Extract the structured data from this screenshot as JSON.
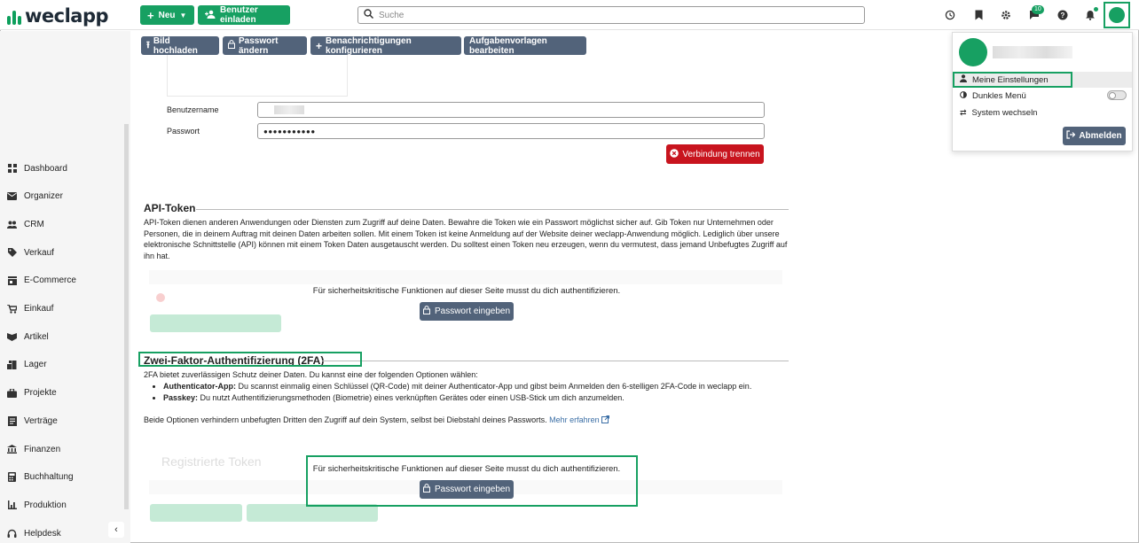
{
  "app": {
    "name": "weclapp"
  },
  "topbar": {
    "new_label": "Neu",
    "invite_label": "Benutzer einladen",
    "search_placeholder": "Suche",
    "notification_count": "10",
    "icons": [
      "history-icon",
      "bookmark-icon",
      "gear-icon",
      "chat-icon",
      "help-icon",
      "bell-icon",
      "avatar"
    ]
  },
  "toolbar": {
    "upload_image": "Bild hochladen",
    "change_password": "Passwort ändern",
    "configure_notifications": "Benachrichtigungen konfigurieren",
    "edit_task_templates": "Aufgabenvorlagen bearbeiten"
  },
  "sidebar": {
    "items": [
      {
        "label": "Dashboard",
        "icon": "dashboard-icon"
      },
      {
        "label": "Organizer",
        "icon": "mail-icon"
      },
      {
        "label": "CRM",
        "icon": "people-icon"
      },
      {
        "label": "Verkauf",
        "icon": "tag-icon"
      },
      {
        "label": "E-Commerce",
        "icon": "store-icon"
      },
      {
        "label": "Einkauf",
        "icon": "cart-icon"
      },
      {
        "label": "Artikel",
        "icon": "box-icon"
      },
      {
        "label": "Lager",
        "icon": "warehouse-icon"
      },
      {
        "label": "Projekte",
        "icon": "briefcase-icon"
      },
      {
        "label": "Verträge",
        "icon": "contract-icon"
      },
      {
        "label": "Finanzen",
        "icon": "bank-icon"
      },
      {
        "label": "Buchhaltung",
        "icon": "calculator-icon"
      },
      {
        "label": "Produktion",
        "icon": "chart-icon"
      },
      {
        "label": "Helpdesk",
        "icon": "headset-icon"
      }
    ]
  },
  "connection": {
    "username_label": "Benutzername",
    "password_label": "Passwort",
    "password_value": "●●●●●●●●●●●",
    "disconnect_label": "Verbindung trennen"
  },
  "api_token": {
    "title": "API-Token",
    "description": "API-Token dienen anderen Anwendungen oder Diensten zum Zugriff auf deine Daten. Bewahre die Token wie ein Passwort möglichst sicher auf. Gib Token nur Unternehmen oder Personen, die in deinem Auftrag mit deinen Daten arbeiten sollen. Mit einem Token ist keine Anmeldung auf der Website deiner weclapp-Anwendung möglich. Lediglich über unsere elektronische Schnittstelle (API) können mit einem Token Daten ausgetauscht werden. Du solltest einen Token neu erzeugen, wenn du vermutest, dass jemand Unbefugtes Zugriff auf ihn hat.",
    "auth_message": "Für sicherheitskritische Funktionen auf dieser Seite musst du dich authentifizieren.",
    "auth_button": "Passwort eingeben"
  },
  "twofa": {
    "title": "Zwei-Faktor-Authentifizierung (2FA)",
    "intro": "2FA bietet zuverlässigen Schutz deiner Daten. Du kannst eine der folgenden Optionen wählen:",
    "options": [
      {
        "name": "Authenticator-App:",
        "text": " Du scannst einmalig einen Schlüssel (QR-Code) mit deiner Authenticator-App und gibst beim Anmelden den 6-stelligen 2FA-Code in weclapp ein."
      },
      {
        "name": "Passkey:",
        "text": " Du nutzt Authentifizierungsmethoden (Biometrie) eines verknüpften Gerätes oder einen USB-Stick um dich anzumelden."
      }
    ],
    "footer": "Beide Optionen verhindern unbefugten Dritten den Zugriff auf dein System, selbst bei Diebstahl deines Passworts.",
    "learn_more": "Mehr erfahren",
    "ghost_title": "Registrierte Token",
    "auth_message": "Für sicherheitskritische Funktionen auf dieser Seite musst du dich authentifizieren.",
    "auth_button": "Passwort eingeben"
  },
  "user_menu": {
    "my_settings": "Meine Einstellungen",
    "dark_menu": "Dunkles Menü",
    "switch_system": "System wechseln",
    "logout": "Abmelden"
  },
  "colors": {
    "brand_green": "#17a062",
    "slate": "#52637a",
    "danger": "#c8141e"
  }
}
